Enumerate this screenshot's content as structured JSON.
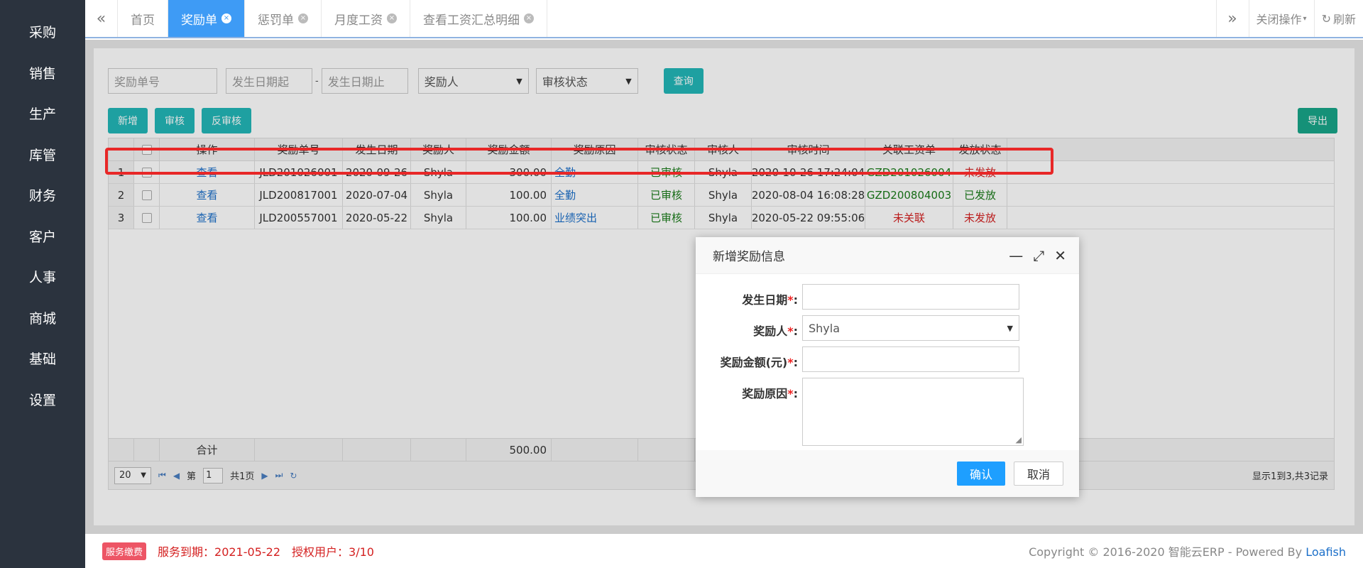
{
  "sidebar": {
    "items": [
      {
        "label": "采购"
      },
      {
        "label": "销售"
      },
      {
        "label": "生产"
      },
      {
        "label": "库管"
      },
      {
        "label": "财务"
      },
      {
        "label": "客户"
      },
      {
        "label": "人事"
      },
      {
        "label": "商城"
      },
      {
        "label": "基础"
      },
      {
        "label": "设置"
      }
    ]
  },
  "tabs": {
    "nav_left_icon": "double-chevron-left-icon",
    "items": [
      {
        "label": "首页",
        "closable": false,
        "active": false
      },
      {
        "label": "奖励单",
        "closable": true,
        "active": true
      },
      {
        "label": "惩罚单",
        "closable": true,
        "active": false
      },
      {
        "label": "月度工资",
        "closable": true,
        "active": false
      },
      {
        "label": "查看工资汇总明细",
        "closable": true,
        "active": false
      }
    ],
    "close_glyph": "×",
    "nav_right_icon": "double-chevron-right-icon",
    "close_ops_label": "关闭操作",
    "refresh_label": "刷新"
  },
  "search": {
    "order_no_placeholder": "奖励单号",
    "date_from_placeholder": "发生日期起",
    "date_sep": "-",
    "date_to_placeholder": "发生日期止",
    "rewardee_select": "奖励人",
    "status_select": "审核状态",
    "query_label": "查询"
  },
  "toolbar": {
    "add_label": "新增",
    "audit_label": "审核",
    "unaudit_label": "反审核",
    "export_label": "导出"
  },
  "grid": {
    "headers": [
      "操作",
      "奖励单号",
      "发生日期",
      "奖励人",
      "奖励金额",
      "奖励原因",
      "审核状态",
      "审核人",
      "审核时间",
      "关联工资单",
      "发放状态"
    ],
    "rows": [
      {
        "num": "1",
        "action": "查看",
        "order_no": "JLD201026001",
        "date": "2020-09-26",
        "person": "Shyla",
        "amount": "300.00",
        "reason": "全勤",
        "audit_status": "已审核",
        "auditor": "Shyla",
        "audit_time": "2020-10-26 17:24:04",
        "payroll": "GZD201026004",
        "payroll_linked": true,
        "pay_status": "未发放",
        "paid": false
      },
      {
        "num": "2",
        "action": "查看",
        "order_no": "JLD200817001",
        "date": "2020-07-04",
        "person": "Shyla",
        "amount": "100.00",
        "reason": "全勤",
        "audit_status": "已审核",
        "auditor": "Shyla",
        "audit_time": "2020-08-04 16:08:28",
        "payroll": "GZD200804003",
        "payroll_linked": true,
        "pay_status": "已发放",
        "paid": true
      },
      {
        "num": "3",
        "action": "查看",
        "order_no": "JLD200557001",
        "date": "2020-05-22",
        "person": "Shyla",
        "amount": "100.00",
        "reason": "业绩突出",
        "audit_status": "已审核",
        "auditor": "Shyla",
        "audit_time": "2020-05-22 09:55:06",
        "payroll": "未关联",
        "payroll_linked": false,
        "pay_status": "未发放",
        "paid": false
      }
    ],
    "footer_label": "合计",
    "footer_total": "500.00"
  },
  "pager": {
    "page_size": "20",
    "page_prefix": "第",
    "page_value": "1",
    "page_suffix": "共1页",
    "summary": "显示1到3,共3记录"
  },
  "dialog": {
    "title": "新增奖励信息",
    "fields": {
      "date_label": "发生日期",
      "person_label": "奖励人",
      "person_value": "Shyla",
      "amount_label": "奖励金额(元)",
      "reason_label": "奖励原因",
      "required_mark": "*",
      "colon": ":"
    },
    "ok_label": "确认",
    "cancel_label": "取消"
  },
  "statusbar": {
    "badge": "服务缴费",
    "expiry": "服务到期：2021-05-22",
    "license": "授权用户：3/10",
    "copyright": "Copyright © 2016-2020 智能云ERP - Powered By ",
    "brand": "Loafish"
  },
  "colors": {
    "sidebar_bg": "#2b333e",
    "tab_active": "#3e9bf5",
    "primary_button": "#23b7b8",
    "export_button": "#18a689",
    "dialog_ok": "#1e9fff",
    "highlight_box": "#e82727"
  }
}
